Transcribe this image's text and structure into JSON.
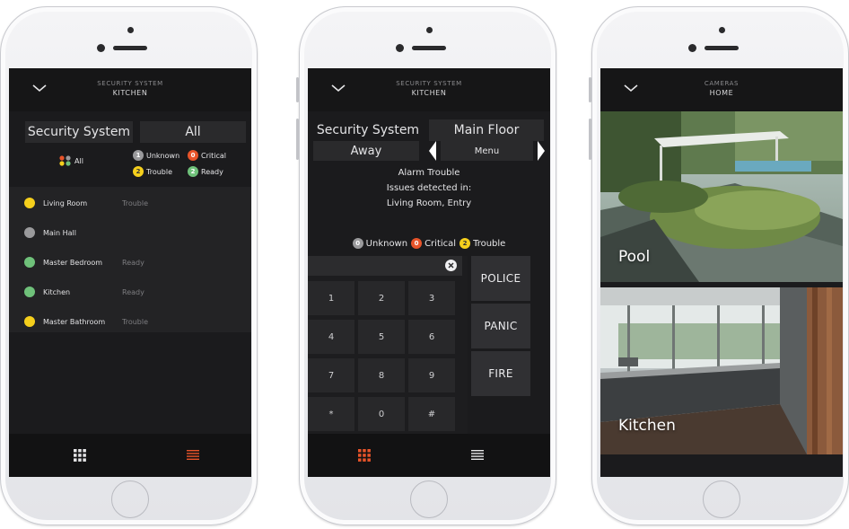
{
  "phone1": {
    "header": {
      "line1": "SECURITY SYSTEM",
      "line2": "KITCHEN"
    },
    "segment": {
      "left": "Security System",
      "right": "All"
    },
    "legend": {
      "all": "All",
      "unknown_count": "1",
      "unknown": "Unknown",
      "critical_count": "0",
      "critical": "Critical",
      "trouble_count": "2",
      "trouble": "Trouble",
      "ready_count": "2",
      "ready": "Ready"
    },
    "rows": [
      {
        "name": "Living Room",
        "status": "Trouble",
        "color": "#f5cf1c"
      },
      {
        "name": "Main Hall",
        "status": "",
        "color": "#9a9a9c"
      },
      {
        "name": "Master Bedroom",
        "status": "Ready",
        "color": "#6fc17a"
      },
      {
        "name": "Kitchen",
        "status": "Ready",
        "color": "#6fc17a"
      },
      {
        "name": "Master Bathroom",
        "status": "Trouble",
        "color": "#f5cf1c"
      }
    ],
    "tabs": {
      "keypad": "grid-icon",
      "list": "list-icon"
    }
  },
  "phone2": {
    "header": {
      "line1": "SECURITY SYSTEM",
      "line2": "KITCHEN"
    },
    "segment": {
      "left": "Security System",
      "right": "Main Floor"
    },
    "mode": "Away",
    "menu": "Menu",
    "message": {
      "line1": "Alarm Trouble",
      "line2": "Issues detected in:",
      "line3": "Living Room, Entry"
    },
    "legend": {
      "unknown_count": "0",
      "unknown": "Unknown",
      "critical_count": "0",
      "critical": "Critical",
      "trouble_count": "2",
      "trouble": "Trouble"
    },
    "keys": [
      "1",
      "2",
      "3",
      "4",
      "5",
      "6",
      "7",
      "8",
      "9",
      "*",
      "0",
      "#"
    ],
    "actions": [
      "POLICE",
      "PANIC",
      "FIRE"
    ]
  },
  "phone3": {
    "header": {
      "line1": "CAMERAS",
      "line2": "HOME"
    },
    "cameras": [
      {
        "label": "Pool"
      },
      {
        "label": "Kitchen"
      }
    ]
  },
  "colors": {
    "accent": "#e8542a",
    "ready": "#6fc17a",
    "trouble": "#f5cf1c",
    "unknown": "#9a9a9c",
    "critical": "#e8542a"
  }
}
